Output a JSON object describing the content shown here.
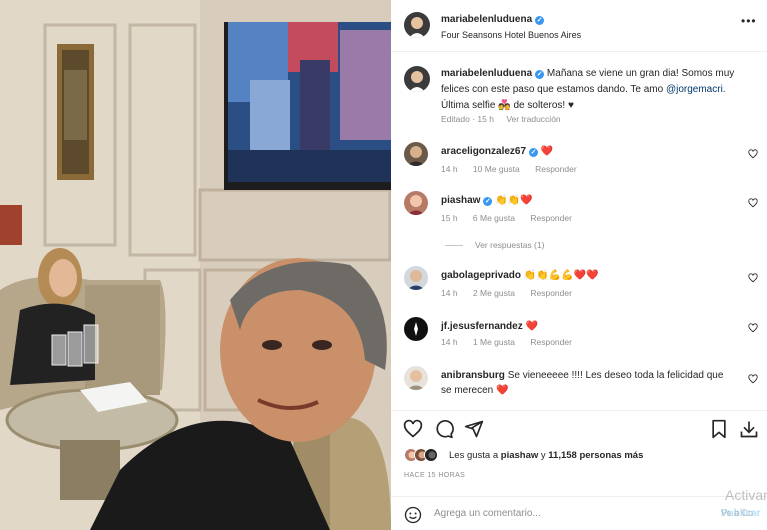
{
  "post": {
    "username": "mariabelenluduena",
    "location": "Four Seansons Hotel Buenos Aires",
    "more_icon": "more-horizontal-icon"
  },
  "caption": {
    "username": "mariabelenluduena",
    "text_before_mention": "Mañana se viene un gran dia! Somos muy felices con este paso que estamos dando. Te amo ",
    "mention": "@jorgemacri.",
    "text_after_mention": " Última selfie ",
    "emoji": "💑",
    "text_end": " de solteros! ♥",
    "edited": "Editado · 15 h",
    "see_translation": "Ver traducción"
  },
  "comments": [
    {
      "username": "araceligonzalez67",
      "verified": true,
      "text": "❤️",
      "time": "14 h",
      "likes": "10 Me gusta",
      "reply": "Responder"
    },
    {
      "username": "piashaw",
      "verified": true,
      "text": "👏👏❤️",
      "time": "15 h",
      "likes": "6 Me gusta",
      "reply": "Responder"
    },
    {
      "username": "gabolageprivado",
      "verified": false,
      "text": "👏👏💪💪❤️❤️",
      "time": "14 h",
      "likes": "2 Me gusta",
      "reply": "Responder"
    },
    {
      "username": "jf.jesusfernandez",
      "verified": false,
      "text": "❤️",
      "time": "14 h",
      "likes": "1 Me gusta",
      "reply": "Responder"
    },
    {
      "username": "anibransburg",
      "verified": false,
      "text": "Se vieneeeee !!!! Les deseo toda la felicidad que se merecen ❤️",
      "time": "",
      "likes": "",
      "reply": ""
    }
  ],
  "view_replies": "Ver respuestas (1)",
  "likes": {
    "prefix": "Les gusta a ",
    "user": "piashaw",
    "middle": " y ",
    "count": "11,158 personas más"
  },
  "time_ago": "HACE 15 HORAS",
  "add_comment": {
    "placeholder": "Agrega un comentario...",
    "post_label": "Publicar"
  },
  "watermark": {
    "line1": "Activar",
    "line2": "Ve a Co"
  },
  "icons": [
    "heart-icon",
    "comment-icon",
    "share-icon",
    "bookmark-icon",
    "download-icon",
    "emoji-icon"
  ],
  "colors": {
    "verified": "#3897f0",
    "heart": "#ed4956",
    "mention": "#00376b",
    "muted": "#8e8e8e"
  }
}
